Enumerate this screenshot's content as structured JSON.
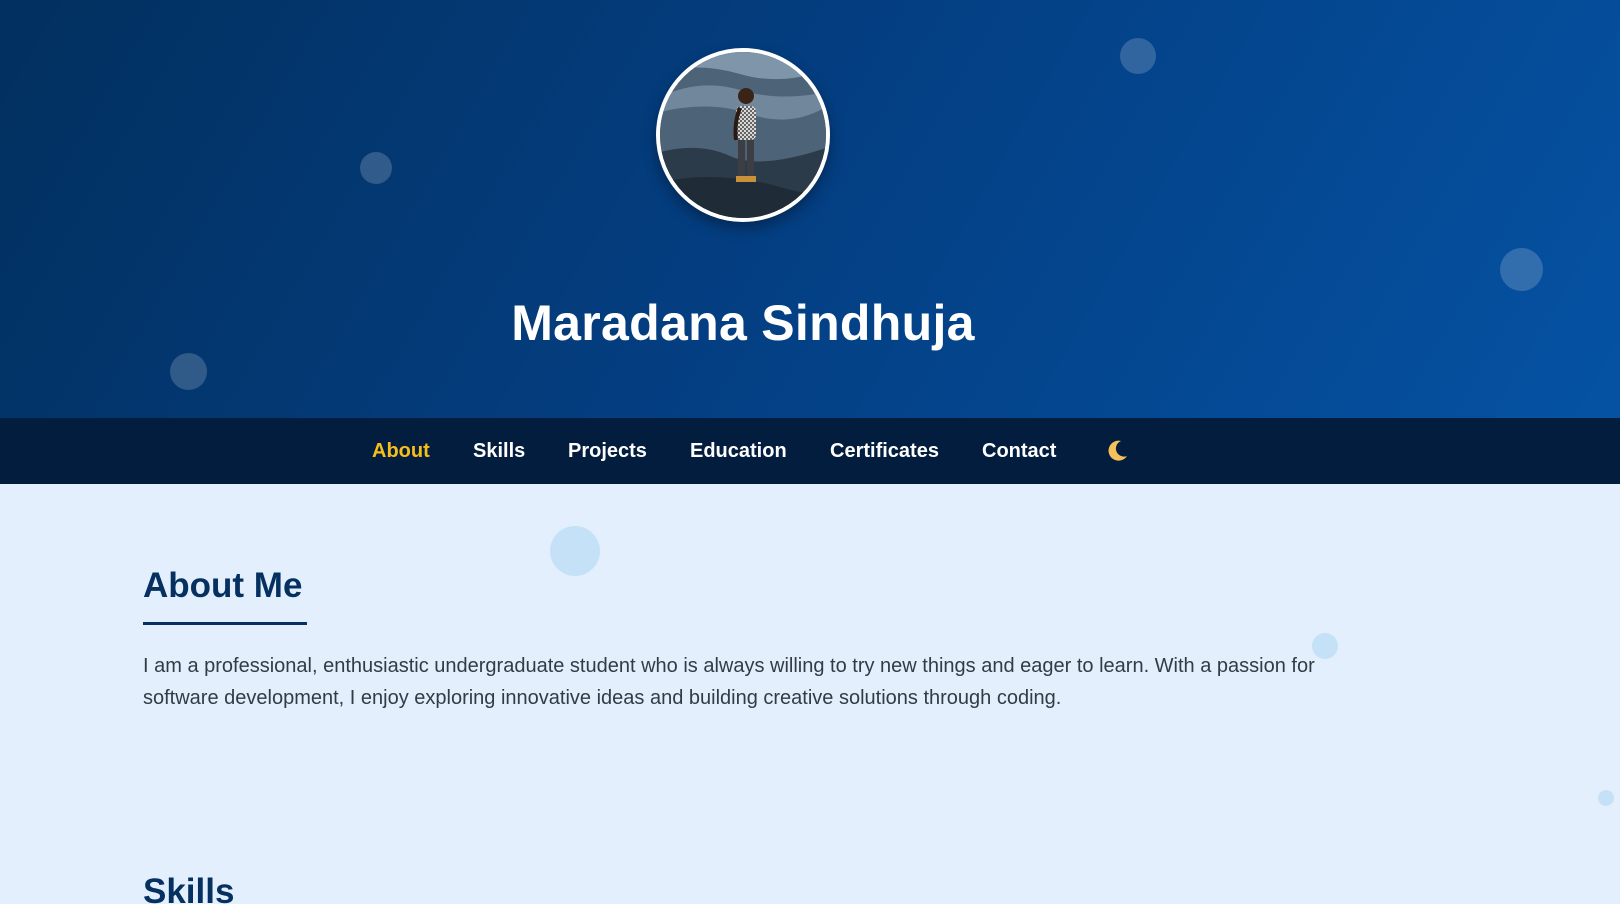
{
  "hero": {
    "name": "Maradana Sindhuja"
  },
  "nav": {
    "items": [
      {
        "label": "About",
        "active": true
      },
      {
        "label": "Skills",
        "active": false
      },
      {
        "label": "Projects",
        "active": false
      },
      {
        "label": "Education",
        "active": false
      },
      {
        "label": "Certificates",
        "active": false
      },
      {
        "label": "Contact",
        "active": false
      }
    ],
    "theme_toggle_icon": "moon-icon"
  },
  "about": {
    "title": "About Me",
    "text": "I am a professional, enthusiastic undergraduate student who is always willing to try new things and eager to learn. With a passion for software development, I enjoy exploring innovative ideas and building creative solutions through coding."
  },
  "skills": {
    "title": "Skills"
  },
  "colors": {
    "hero_gradient_start": "#02305f",
    "hero_gradient_end": "#0552a3",
    "nav_background": "#031d3f",
    "nav_active": "#f7be1b",
    "content_background": "#e3effd",
    "heading": "#05305f"
  }
}
